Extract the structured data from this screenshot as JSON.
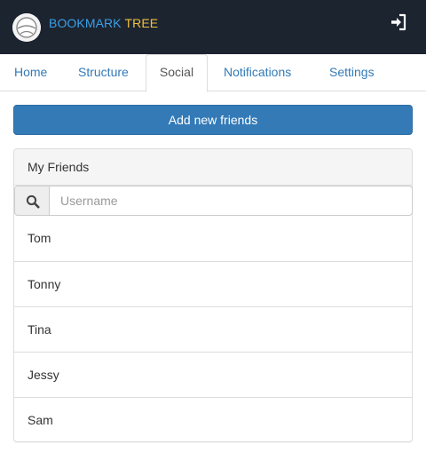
{
  "app": {
    "brand_primary": "BOOKMARK",
    "brand_secondary": "TREE",
    "colors": {
      "header_bg": "#1c2430",
      "brand_primary": "#3aa0e8",
      "brand_secondary": "#f0c040",
      "accent": "#337ab7"
    }
  },
  "header": {
    "logo_icon": "avatar-logo-icon",
    "logout_icon": "sign-in-icon"
  },
  "tabs": [
    {
      "label": "Home",
      "active": false
    },
    {
      "label": "Structure",
      "active": false
    },
    {
      "label": "Social",
      "active": true
    },
    {
      "label": "Notifications",
      "active": false
    },
    {
      "label": "Settings",
      "active": false
    }
  ],
  "actions": {
    "add_friends_label": "Add new friends"
  },
  "friends_panel": {
    "title": "My Friends",
    "search_icon": "search-icon",
    "search_placeholder": "Username",
    "search_value": "",
    "friends": [
      "Tom",
      "Tonny",
      "Tina",
      "Jessy",
      "Sam"
    ]
  }
}
